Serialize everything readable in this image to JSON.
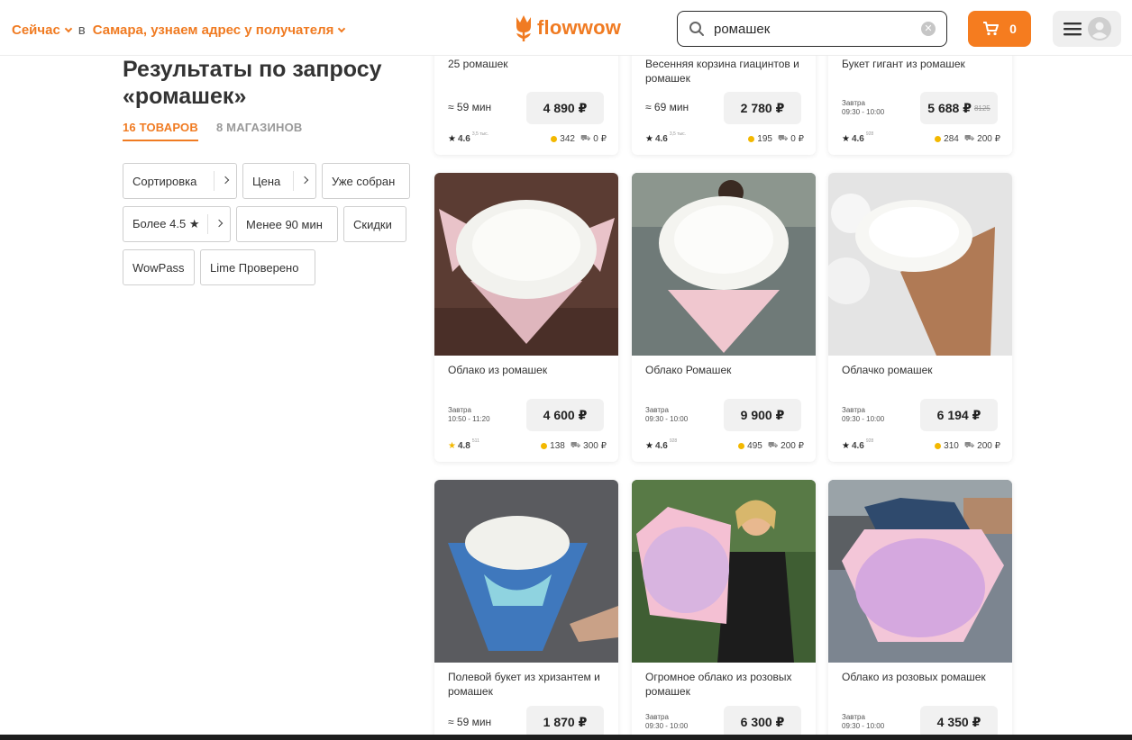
{
  "header": {
    "now_label": "Сейчас",
    "in_label": "в",
    "city_label": "Самара, узнаем адрес у получателя",
    "logo_text": "flowwow",
    "search_value": "ромашек",
    "cart_count": "0"
  },
  "results": {
    "title_line1": "Результаты по запросу",
    "title_line2": "«ромашек»",
    "tab_products": "16 ТОВАРОВ",
    "tab_shops": "8 МАГАЗИНОВ"
  },
  "filters": {
    "sort": "Сортировка",
    "price": "Цена",
    "ready": "Уже собран",
    "rating": "Более 4.5 ★",
    "fast": "Менее 90 мин",
    "discounts": "Скидки",
    "wowpass": "WowPass",
    "lime": "Lime Проверено"
  },
  "products": [
    {
      "name": "25 ромашек",
      "eta": "≈ 59 мин",
      "price": "4 890 ₽",
      "rating": "4.6",
      "reviews": "3,5 тыс.",
      "coins": "342",
      "delivery": "0 ₽"
    },
    {
      "name": "Весенняя корзина гиацинтов и ромашек",
      "eta": "≈ 69 мин",
      "price": "2 780 ₽",
      "rating": "4.6",
      "reviews": "3,5 тыс.",
      "coins": "195",
      "delivery": "0 ₽"
    },
    {
      "name": "Букет гигант из ромашек",
      "eta_day": "Завтра",
      "eta_time": "09:30 - 10:00",
      "price": "5 688 ₽",
      "old_price": "8125",
      "rating": "4.6",
      "reviews": "928",
      "coins": "284",
      "delivery": "200 ₽"
    },
    {
      "name": "Облако из ромашек",
      "eta_day": "Завтра",
      "eta_time": "10:50 - 11:20",
      "price": "4 600 ₽",
      "rating": "4.8",
      "reviews": "511",
      "coins": "138",
      "delivery": "300 ₽"
    },
    {
      "name": "Облако Ромашек",
      "eta_day": "Завтра",
      "eta_time": "09:30 - 10:00",
      "price": "9 900 ₽",
      "rating": "4.6",
      "reviews": "928",
      "coins": "495",
      "delivery": "200 ₽"
    },
    {
      "name": "Облачко ромашек",
      "eta_day": "Завтра",
      "eta_time": "09:30 - 10:00",
      "price": "6 194 ₽",
      "rating": "4.6",
      "reviews": "928",
      "coins": "310",
      "delivery": "200 ₽"
    },
    {
      "name": "Полевой букет из хризантем и ромашек",
      "eta": "≈ 59 мин",
      "price": "1 870 ₽"
    },
    {
      "name": "Огромное облако из розовых ромашек",
      "eta_day": "Завтра",
      "eta_time": "09:30 - 10:00",
      "price": "6 300 ₽"
    },
    {
      "name": "Облако из розовых ромашек",
      "eta_day": "Завтра",
      "eta_time": "09:30 - 10:00",
      "price": "4 350 ₽"
    }
  ],
  "colors": {
    "accent": "#f07b22",
    "cart": "#f57c1f",
    "star_gold": "#f3b800"
  }
}
